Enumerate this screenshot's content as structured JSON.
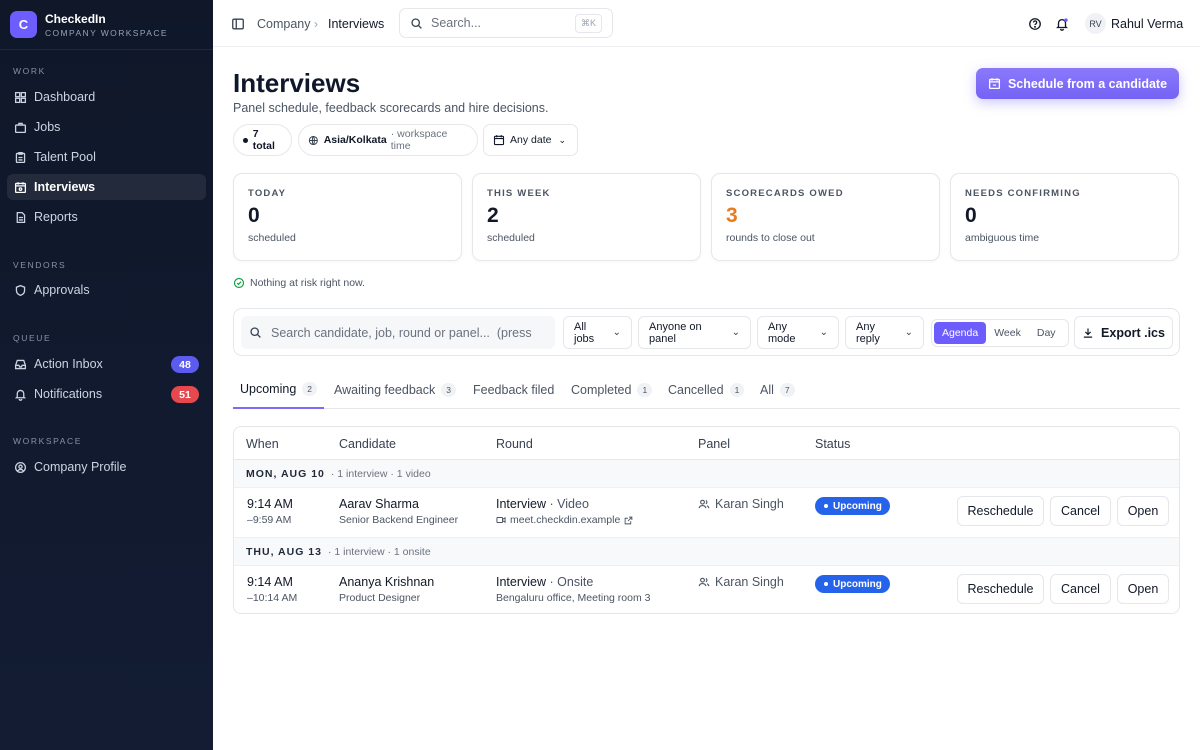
{
  "brand": {
    "logo_letter": "C",
    "name": "CheckedIn",
    "subtitle": "COMPANY WORKSPACE"
  },
  "sidebar": {
    "sections": [
      {
        "title": "WORK",
        "items": [
          {
            "label": "Dashboard",
            "icon": "dashboard-icon"
          },
          {
            "label": "Jobs",
            "icon": "briefcase-icon"
          },
          {
            "label": "Talent Pool",
            "icon": "clipboard-icon"
          },
          {
            "label": "Interviews",
            "icon": "calendar-icon",
            "active": true
          },
          {
            "label": "Reports",
            "icon": "document-icon"
          }
        ]
      },
      {
        "title": "VENDORS",
        "items": [
          {
            "label": "Approvals",
            "icon": "shield-icon"
          }
        ]
      },
      {
        "title": "QUEUE",
        "items": [
          {
            "label": "Action Inbox",
            "icon": "inbox-icon",
            "badge": "48",
            "badge_color": "#5b5bf0"
          },
          {
            "label": "Notifications",
            "icon": "bell-icon",
            "badge": "51",
            "badge_color": "#e5484d"
          }
        ]
      },
      {
        "title": "WORKSPACE",
        "items": [
          {
            "label": "Company Profile",
            "icon": "user-circle-icon"
          }
        ]
      }
    ]
  },
  "topbar": {
    "breadcrumb": [
      "Company",
      "Interviews"
    ],
    "search_placeholder": "Search...",
    "search_shortcut": "⌘K",
    "user_initials": "RV",
    "user_name": "Rahul Verma"
  },
  "page": {
    "title": "Interviews",
    "subtitle": "Panel schedule, feedback scorecards and hire decisions.",
    "cta_label": "Schedule from a candidate",
    "chips": {
      "total": "7 total",
      "timezone": "Asia/Kolkata",
      "timezone_note": "· workspace time",
      "date": "Any date"
    }
  },
  "stats": [
    {
      "label": "TODAY",
      "value": "0",
      "sub": "scheduled",
      "color": "#111827"
    },
    {
      "label": "THIS WEEK",
      "value": "2",
      "sub": "scheduled",
      "color": "#111827"
    },
    {
      "label": "SCORECARDS OWED",
      "value": "3",
      "sub": "rounds to close out",
      "color": "#ea7a1a"
    },
    {
      "label": "NEEDS CONFIRMING",
      "value": "0",
      "sub": "ambiguous time",
      "color": "#111827"
    }
  ],
  "risk_note": "Nothing at risk right now.",
  "filters": {
    "search_placeholder": "Search candidate, job, round or panel...  (press",
    "jobs": "All jobs",
    "panel": "Anyone on panel",
    "mode": "Any mode",
    "reply": "Any reply",
    "views": [
      "Agenda",
      "Week",
      "Day"
    ],
    "active_view": "Agenda",
    "export_label": "Export .ics"
  },
  "tabs": [
    {
      "label": "Upcoming",
      "count": "2",
      "active": true
    },
    {
      "label": "Awaiting feedback",
      "count": "3"
    },
    {
      "label": "Feedback filed",
      "count": ""
    },
    {
      "label": "Completed",
      "count": "1"
    },
    {
      "label": "Cancelled",
      "count": "1"
    },
    {
      "label": "All",
      "count": "7"
    }
  ],
  "table": {
    "columns": [
      "When",
      "Candidate",
      "Round",
      "Panel",
      "Status"
    ],
    "groups": [
      {
        "day": "MON, AUG 10",
        "meta": "· 1 interview · 1 video",
        "rows": [
          {
            "start": "9:14 AM",
            "end": "–9:59 AM",
            "candidate": "Aarav Sharma",
            "role": "Senior Backend Engineer",
            "round": "Interview",
            "mode": "· Video",
            "location": "meet.checkdin.example",
            "panel": "Karan Singh",
            "status": "Upcoming"
          }
        ]
      },
      {
        "day": "THU, AUG 13",
        "meta": "· 1 interview · 1 onsite",
        "rows": [
          {
            "start": "9:14 AM",
            "end": "–10:14 AM",
            "candidate": "Ananya Krishnan",
            "role": "Product Designer",
            "round": "Interview",
            "mode": "· Onsite",
            "location": "Bengaluru office, Meeting room 3",
            "panel": "Karan Singh",
            "status": "Upcoming"
          }
        ]
      }
    ],
    "actions": {
      "reschedule": "Reschedule",
      "cancel": "Cancel",
      "open": "Open"
    }
  },
  "colors": {
    "accent": "#6d5dfc",
    "status_blue": "#2563eb",
    "warning": "#ea7a1a",
    "sidebar_bg": "#0f1729"
  }
}
